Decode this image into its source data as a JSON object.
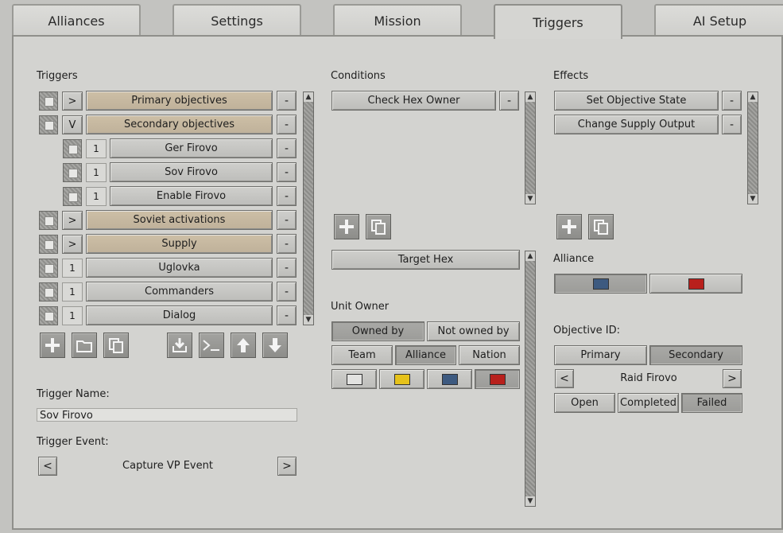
{
  "tabs": [
    "Alliances",
    "Settings",
    "Mission",
    "Triggers",
    "AI Setup"
  ],
  "triggers": {
    "title": "Triggers",
    "items": [
      {
        "toggle": ">",
        "label": "Primary objectives"
      },
      {
        "toggle": "V",
        "label": "Secondary objectives"
      },
      {
        "toggle": "1",
        "label": "Ger Firovo"
      },
      {
        "toggle": "1",
        "label": "Sov Firovo"
      },
      {
        "toggle": "1",
        "label": "Enable Firovo"
      },
      {
        "toggle": ">",
        "label": "Soviet activations"
      },
      {
        "toggle": ">",
        "label": "Supply"
      },
      {
        "toggle": "1",
        "label": "Uglovka"
      },
      {
        "toggle": "1",
        "label": "Commanders"
      },
      {
        "toggle": "1",
        "label": "Dialog"
      }
    ],
    "remove_label": "-",
    "toolbar_icons": [
      "add-icon",
      "folder-icon",
      "copy-icon",
      "import-icon",
      "console-icon",
      "arrow-up-icon",
      "arrow-down-icon"
    ],
    "name_label": "Trigger Name:",
    "name_value": "Sov Firovo",
    "event_label": "Trigger Event:",
    "event_value": "Capture VP Event",
    "prev": "<",
    "next": ">"
  },
  "conditions": {
    "title": "Conditions",
    "items": [
      "Check Hex Owner"
    ],
    "remove_label": "-",
    "target_hex_label": "Target Hex",
    "unit_owner_label": "Unit Owner",
    "owned_by": "Owned by",
    "not_owned_by": "Not owned by",
    "team": "Team",
    "alliance": "Alliance",
    "nation": "Nation",
    "colors": [
      "#e2e2e0",
      "#e6c21a",
      "#3d5a80",
      "#b8201c"
    ]
  },
  "effects": {
    "title": "Effects",
    "items": [
      "Set Objective State",
      "Change Supply Output"
    ],
    "remove_label": "-",
    "alliance_label": "Alliance",
    "alliance_colors": [
      "#3d5a80",
      "#b8201c"
    ],
    "objective_id_label": "Objective ID:",
    "primary": "Primary",
    "secondary": "Secondary",
    "objective_value": "Raid Firovo",
    "prev": "<",
    "next": ">",
    "open": "Open",
    "completed": "Completed",
    "failed": "Failed"
  }
}
